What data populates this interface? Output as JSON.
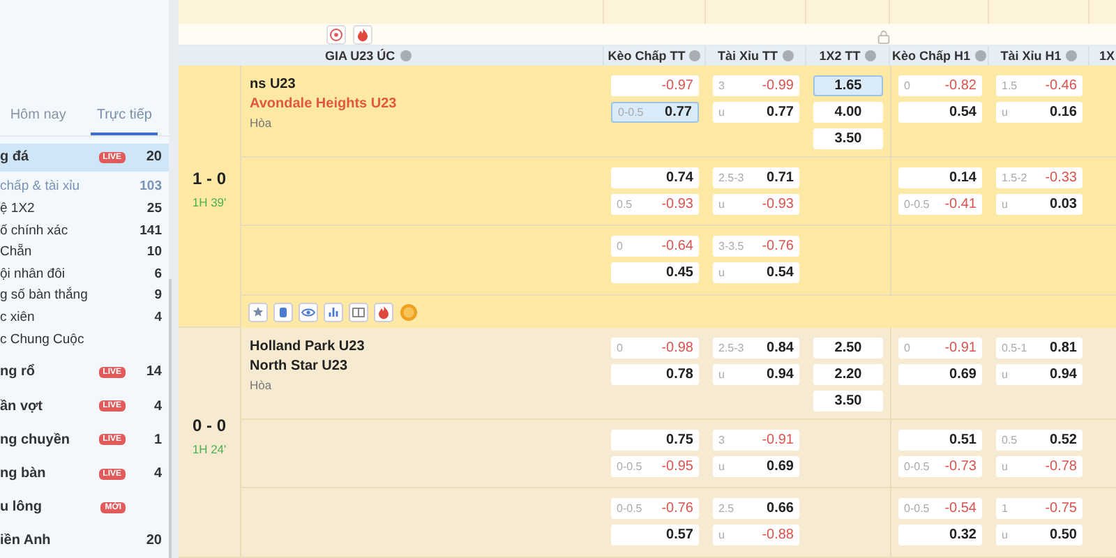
{
  "sidebar": {
    "tabs": [
      {
        "label": "Hôm nay",
        "selected": false
      },
      {
        "label": "Trực tiếp",
        "selected": true
      }
    ],
    "sports": [
      {
        "name": "g đá",
        "badge": "LIVE",
        "count": "20",
        "selected": true,
        "expanded": true,
        "children": [
          {
            "name": "chấp & tài xỉu",
            "count": "103",
            "selected": true
          },
          {
            "name": "ệ 1X2",
            "count": "25",
            "selected": false
          },
          {
            "name": "ố chính xác",
            "count": "141",
            "selected": false
          },
          {
            "name": "Chẵn",
            "count": "10",
            "selected": false
          },
          {
            "name": "ội nhân đôi",
            "count": "6",
            "selected": false
          },
          {
            "name": "g số bàn thắng",
            "count": "9",
            "selected": false
          },
          {
            "name": "c xiên",
            "count": "4",
            "selected": false
          },
          {
            "name": "c Chung Cuộc",
            "selected": false
          }
        ]
      },
      {
        "name": "ng rổ",
        "badge": "LIVE",
        "count": "14",
        "selected": false,
        "expanded": false
      },
      {
        "name": "ần vợt",
        "badge": "LIVE",
        "count": "4",
        "selected": false,
        "expanded": false
      },
      {
        "name": "ng chuyền",
        "badge": "LIVE",
        "count": "1",
        "selected": false,
        "expanded": false
      },
      {
        "name": "ng bàn",
        "badge": "LIVE",
        "count": "4",
        "selected": false,
        "expanded": false
      },
      {
        "name": "u lông",
        "badge": "MỚI",
        "selected": false,
        "expanded": false
      },
      {
        "name": "iền Anh",
        "count": "20",
        "selected": false,
        "expanded": false
      }
    ]
  },
  "league": {
    "name": "GIA U23 ÚC"
  },
  "columns": [
    {
      "label": "Kèo Chấp TT"
    },
    {
      "label": "Tài Xỉu TT"
    },
    {
      "label": "1X2 TT"
    },
    {
      "label": "Kèo Chấp H1"
    },
    {
      "label": "Tài Xỉu H1"
    },
    {
      "label": "1X"
    }
  ],
  "matches": [
    {
      "score": "1 - 0",
      "time": "1H 39'",
      "highlighted": true,
      "teams": [
        {
          "name": "ns U23",
          "highlighted": false
        },
        {
          "name": "Avondale Heights U23",
          "highlighted": true
        }
      ],
      "draw": "Hòa",
      "lines": [
        {
          "markets": [
            {
              "kind": "pair",
              "odds": [
                {
                  "v": "-0.97",
                  "negative": true,
                  "selected": false
                },
                {
                  "l": "0-0.5",
                  "v": "0.77",
                  "negative": false,
                  "selected": true
                }
              ]
            },
            {
              "kind": "pair",
              "odds": [
                {
                  "l": "3",
                  "v": "-0.99",
                  "negative": true,
                  "selected": false
                },
                {
                  "l": "u",
                  "v": "0.77",
                  "negative": false,
                  "selected": false
                }
              ]
            },
            {
              "kind": "single",
              "odds": [
                {
                  "v": "1.65",
                  "selected": true
                },
                {
                  "v": "4.00",
                  "selected": false
                },
                {
                  "v": "3.50",
                  "selected": false
                }
              ]
            },
            {
              "kind": "pair",
              "odds": [
                {
                  "l": "0",
                  "v": "-0.82",
                  "negative": true,
                  "selected": false
                },
                {
                  "v": "0.54",
                  "negative": false,
                  "selected": false
                }
              ]
            },
            {
              "kind": "pair",
              "odds": [
                {
                  "l": "1.5",
                  "v": "-0.46",
                  "negative": true,
                  "selected": false
                },
                {
                  "l": "u",
                  "v": "0.16",
                  "negative": false,
                  "selected": false
                }
              ]
            }
          ]
        },
        {
          "markets": [
            {
              "kind": "pair",
              "odds": [
                {
                  "v": "0.74",
                  "negative": false,
                  "selected": false
                },
                {
                  "l": "0.5",
                  "v": "-0.93",
                  "negative": true,
                  "selected": false
                }
              ]
            },
            {
              "kind": "pair",
              "odds": [
                {
                  "l": "2.5-3",
                  "v": "0.71",
                  "negative": false,
                  "selected": false
                },
                {
                  "l": "u",
                  "v": "-0.93",
                  "negative": true,
                  "selected": false
                }
              ]
            },
            {
              "kind": "blank"
            },
            {
              "kind": "pair",
              "odds": [
                {
                  "v": "0.14",
                  "negative": false,
                  "selected": false
                },
                {
                  "l": "0-0.5",
                  "v": "-0.41",
                  "negative": true,
                  "selected": false
                }
              ]
            },
            {
              "kind": "pair",
              "odds": [
                {
                  "l": "1.5-2",
                  "v": "-0.33",
                  "negative": true,
                  "selected": false
                },
                {
                  "l": "u",
                  "v": "0.03",
                  "negative": false,
                  "selected": false
                }
              ]
            }
          ]
        },
        {
          "markets": [
            {
              "kind": "pair",
              "odds": [
                {
                  "l": "0",
                  "v": "-0.64",
                  "negative": true,
                  "selected": false
                },
                {
                  "v": "0.45",
                  "negative": false,
                  "selected": false
                }
              ]
            },
            {
              "kind": "pair",
              "odds": [
                {
                  "l": "3-3.5",
                  "v": "-0.76",
                  "negative": true,
                  "selected": false
                },
                {
                  "l": "u",
                  "v": "0.54",
                  "negative": false,
                  "selected": false
                }
              ]
            }
          ]
        }
      ]
    },
    {
      "score": "0 - 0",
      "time": "1H 24'",
      "highlighted": false,
      "teams": [
        {
          "name": "Holland Park U23",
          "highlighted": false
        },
        {
          "name": "North Star U23",
          "highlighted": false
        }
      ],
      "draw": "Hòa",
      "lines": [
        {
          "markets": [
            {
              "kind": "pair",
              "odds": [
                {
                  "l": "0",
                  "v": "-0.98",
                  "negative": true,
                  "selected": false
                },
                {
                  "v": "0.78",
                  "negative": false,
                  "selected": false
                }
              ]
            },
            {
              "kind": "pair",
              "odds": [
                {
                  "l": "2.5-3",
                  "v": "0.84",
                  "negative": false,
                  "selected": false
                },
                {
                  "l": "u",
                  "v": "0.94",
                  "negative": false,
                  "selected": false
                }
              ]
            },
            {
              "kind": "single",
              "odds": [
                {
                  "v": "2.50",
                  "selected": false
                },
                {
                  "v": "2.20",
                  "selected": false
                },
                {
                  "v": "3.50",
                  "selected": false
                }
              ]
            },
            {
              "kind": "pair",
              "odds": [
                {
                  "l": "0",
                  "v": "-0.91",
                  "negative": true,
                  "selected": false
                },
                {
                  "v": "0.69",
                  "negative": false,
                  "selected": false
                }
              ]
            },
            {
              "kind": "pair",
              "odds": [
                {
                  "l": "0.5-1",
                  "v": "0.81",
                  "negative": false,
                  "selected": false
                },
                {
                  "l": "u",
                  "v": "0.94",
                  "negative": false,
                  "selected": false
                }
              ]
            }
          ]
        },
        {
          "markets": [
            {
              "kind": "pair",
              "odds": [
                {
                  "v": "0.75",
                  "negative": false,
                  "selected": false
                },
                {
                  "l": "0-0.5",
                  "v": "-0.95",
                  "negative": true,
                  "selected": false
                }
              ]
            },
            {
              "kind": "pair",
              "odds": [
                {
                  "l": "3",
                  "v": "-0.91",
                  "negative": true,
                  "selected": false
                },
                {
                  "l": "u",
                  "v": "0.69",
                  "negative": false,
                  "selected": false
                }
              ]
            },
            {
              "kind": "blank"
            },
            {
              "kind": "pair",
              "odds": [
                {
                  "v": "0.51",
                  "negative": false,
                  "selected": false
                },
                {
                  "l": "0-0.5",
                  "v": "-0.73",
                  "negative": true,
                  "selected": false
                }
              ]
            },
            {
              "kind": "pair",
              "odds": [
                {
                  "l": "0.5",
                  "v": "0.52",
                  "negative": false,
                  "selected": false
                },
                {
                  "l": "u",
                  "v": "-0.78",
                  "negative": true,
                  "selected": false
                }
              ]
            }
          ]
        },
        {
          "markets": [
            {
              "kind": "pair",
              "odds": [
                {
                  "l": "0-0.5",
                  "v": "-0.76",
                  "negative": true,
                  "selected": false
                },
                {
                  "v": "0.57",
                  "negative": false,
                  "selected": false
                }
              ]
            },
            {
              "kind": "pair",
              "odds": [
                {
                  "l": "2.5",
                  "v": "0.66",
                  "negative": false,
                  "selected": false
                },
                {
                  "l": "u",
                  "v": "-0.88",
                  "negative": true,
                  "selected": false
                }
              ]
            },
            {
              "kind": "blank"
            },
            {
              "kind": "pair",
              "odds": [
                {
                  "l": "0-0.5",
                  "v": "-0.54",
                  "negative": true,
                  "selected": false
                },
                {
                  "v": "0.32",
                  "negative": false,
                  "selected": false
                }
              ]
            },
            {
              "kind": "pair",
              "odds": [
                {
                  "l": "1",
                  "v": "-0.75",
                  "negative": true,
                  "selected": false
                },
                {
                  "l": "u",
                  "v": "0.50",
                  "negative": false,
                  "selected": false
                }
              ]
            }
          ]
        }
      ]
    }
  ]
}
